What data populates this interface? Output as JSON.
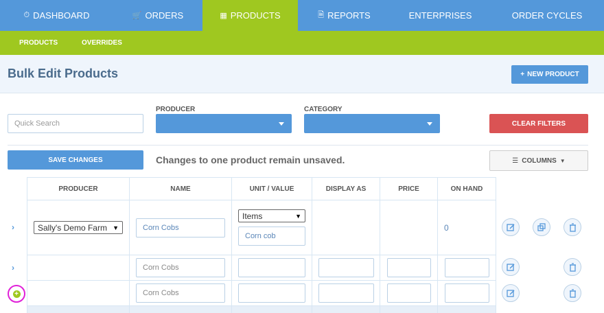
{
  "nav": {
    "items": [
      {
        "label": "DASHBOARD",
        "icon": "dashboard-icon",
        "active": false
      },
      {
        "label": "ORDERS",
        "icon": "cart-icon",
        "active": false
      },
      {
        "label": "PRODUCTS",
        "icon": "products-icon",
        "active": true
      },
      {
        "label": "REPORTS",
        "icon": "report-icon",
        "active": false
      },
      {
        "label": "ENTERPRISES",
        "icon": "",
        "active": false
      },
      {
        "label": "ORDER CYCLES",
        "icon": "",
        "active": false
      }
    ]
  },
  "subnav": {
    "products": "PRODUCTS",
    "overrides": "OVERRIDES"
  },
  "header": {
    "title": "Bulk Edit Products",
    "new_product": "NEW PRODUCT"
  },
  "filters": {
    "search_placeholder": "Quick Search",
    "producer_label": "PRODUCER",
    "category_label": "CATEGORY",
    "clear": "CLEAR FILTERS"
  },
  "actions": {
    "save": "SAVE CHANGES",
    "status": "Changes to one product remain unsaved.",
    "columns": "COLUMNS"
  },
  "table": {
    "headers": [
      "PRODUCER",
      "NAME",
      "UNIT / VALUE",
      "DISPLAY AS",
      "PRICE",
      "ON HAND"
    ],
    "product": {
      "producer": "Sally's Demo Farm",
      "name": "Corn Cobs",
      "unit": "Items",
      "unit_value": "Corn cob",
      "on_hand": "0"
    },
    "variants": [
      {
        "name_placeholder": "Corn Cobs"
      },
      {
        "name_placeholder": "Corn Cobs"
      }
    ]
  },
  "colors": {
    "nav_blue": "#5498da",
    "active_green": "#9fc820",
    "clear_red": "#da5354",
    "highlight_magenta": "#e020d8"
  }
}
